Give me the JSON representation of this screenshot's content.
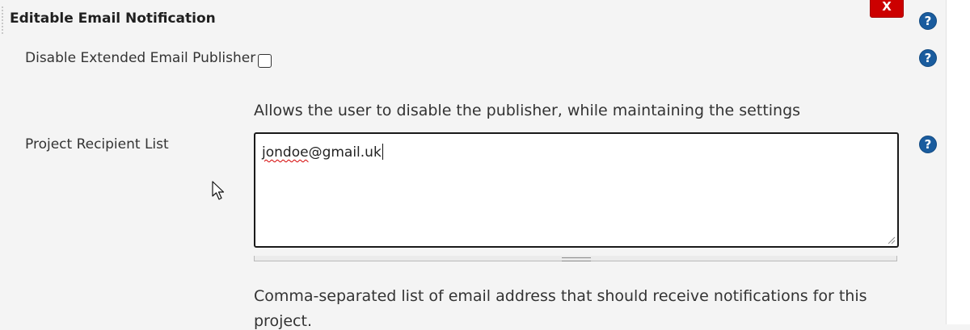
{
  "section": {
    "title": "Editable Email Notification",
    "delete_label": "X"
  },
  "fields": {
    "disable_publisher": {
      "label": "Disable Extended Email Publisher",
      "checked": false,
      "description": "Allows the user to disable the publisher, while maintaining the settings"
    },
    "recipient_list": {
      "label": "Project Recipient List",
      "value_misspelled": "jondoe",
      "value_rest": "@gmail.uk",
      "description_line1": "Comma-separated list of email address that should receive notifications for this",
      "description_line2": "project."
    }
  },
  "help": {
    "glyph": "?"
  },
  "colors": {
    "delete_button": "#cc0000",
    "help_icon": "#1a5c9e",
    "background": "#f4f4f4",
    "spellcheck_underline": "#d40000"
  },
  "icons": {
    "help": "help-icon",
    "cursor": "mouse-pointer-icon",
    "resize": "resize-grip-icon"
  }
}
